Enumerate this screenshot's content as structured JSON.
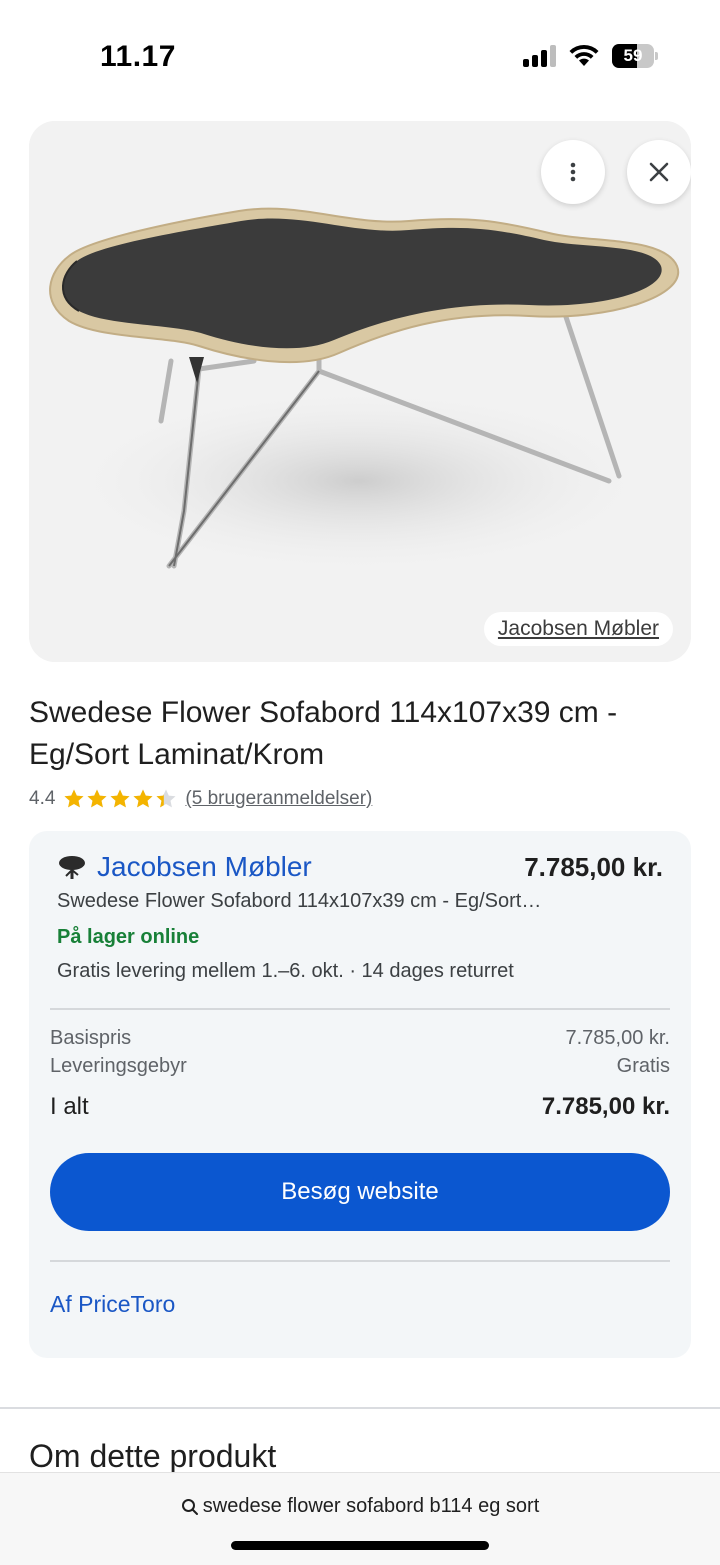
{
  "status_bar": {
    "time": "11.17",
    "battery": "59",
    "battery_level": 0.59
  },
  "product": {
    "image_alt": "Swedese Flower sofabord",
    "merchant_chip": "Jacobsen Møbler",
    "title": "Swedese Flower Sofabord 114x107x39 cm - Eg/Sort Laminat/Krom",
    "rating": "4.4",
    "rating_stars": 4.4,
    "reviews": "(5 brugeranmeldelser)"
  },
  "offer": {
    "seller": "Jacobsen Møbler",
    "price": "7.785,00 kr.",
    "description": "Swedese Flower Sofabord 114x107x39 cm - Eg/Sort…",
    "stock": "På lager online",
    "delivery": "Gratis levering mellem 1.–6. okt. · 14 dages returret",
    "base_label": "Basispris",
    "base_value": "7.785,00 kr.",
    "shipping_label": "Leveringsgebyr",
    "shipping_value": "Gratis",
    "total_label": "I alt",
    "total_value": "7.785,00 kr.",
    "visit_button": "Besøg website",
    "provider_link": "Af PriceToro"
  },
  "about": {
    "title": "Om dette produkt"
  },
  "search": {
    "query": "swedese flower sofabord b114 eg sort"
  },
  "colors": {
    "accent": "#0b57d0",
    "link": "#1a57c5",
    "stock": "#188038",
    "star": "#f4b400"
  }
}
